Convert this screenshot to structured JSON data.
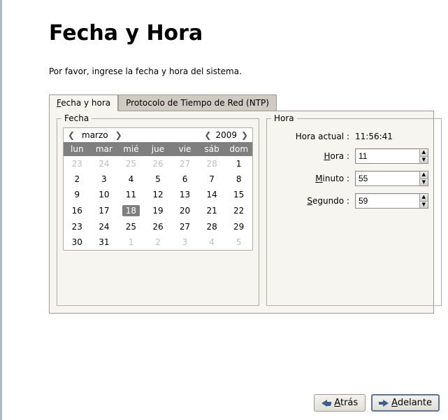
{
  "header": {
    "title": "Fecha y Hora"
  },
  "instruction": "Por favor, ingrese la fecha y hora del sistema.",
  "tabs": {
    "datetime_label_pre": "F",
    "datetime_label_post": "echa y hora",
    "ntp_label": "Protocolo de Tiempo de Red (NTP)"
  },
  "date": {
    "legend": "Fecha",
    "nav_prev": "❮",
    "nav_next": "❯",
    "month": "marzo",
    "year_prev": "❮",
    "year": "2009",
    "year_next": "❯",
    "weekdays": [
      "lun",
      "mar",
      "mié",
      "jue",
      "vie",
      "sáb",
      "dom"
    ],
    "grid": [
      [
        {
          "d": "23",
          "dim": true
        },
        {
          "d": "24",
          "dim": true
        },
        {
          "d": "25",
          "dim": true
        },
        {
          "d": "26",
          "dim": true
        },
        {
          "d": "27",
          "dim": true
        },
        {
          "d": "28",
          "dim": true
        },
        {
          "d": "1"
        }
      ],
      [
        {
          "d": "2"
        },
        {
          "d": "3"
        },
        {
          "d": "4"
        },
        {
          "d": "5"
        },
        {
          "d": "6"
        },
        {
          "d": "7"
        },
        {
          "d": "8"
        }
      ],
      [
        {
          "d": "9"
        },
        {
          "d": "10"
        },
        {
          "d": "11"
        },
        {
          "d": "12"
        },
        {
          "d": "13"
        },
        {
          "d": "14"
        },
        {
          "d": "15"
        }
      ],
      [
        {
          "d": "16"
        },
        {
          "d": "17"
        },
        {
          "d": "18",
          "sel": true
        },
        {
          "d": "19"
        },
        {
          "d": "20"
        },
        {
          "d": "21"
        },
        {
          "d": "22"
        }
      ],
      [
        {
          "d": "23"
        },
        {
          "d": "24"
        },
        {
          "d": "25"
        },
        {
          "d": "26"
        },
        {
          "d": "27"
        },
        {
          "d": "28"
        },
        {
          "d": "29"
        }
      ],
      [
        {
          "d": "30"
        },
        {
          "d": "31"
        },
        {
          "d": "1",
          "dim": true
        },
        {
          "d": "2",
          "dim": true
        },
        {
          "d": "3",
          "dim": true
        },
        {
          "d": "4",
          "dim": true
        },
        {
          "d": "5",
          "dim": true
        }
      ]
    ]
  },
  "time": {
    "legend": "Hora",
    "current_label": "Hora actual :",
    "current_value": "11:56:41",
    "hour_pre": "H",
    "hour_post": "ora :",
    "hour_value": "11",
    "minute_pre": "M",
    "minute_post": "inuto :",
    "minute_value": "55",
    "second_pre": "S",
    "second_post": "egundo :",
    "second_value": "59"
  },
  "footer": {
    "back_pre": "A",
    "back_post": "trás",
    "fwd_pre": "A",
    "fwd_post": "delante"
  },
  "icons": {
    "up": "▲",
    "down": "▼"
  }
}
